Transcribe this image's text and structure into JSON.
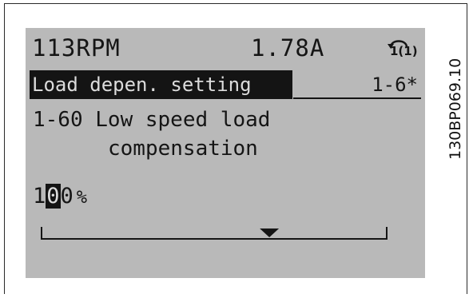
{
  "status": {
    "speed": "113RPM",
    "current": "1.78A",
    "active_setup": "1(1)",
    "setup_icon": "setup-arrow-icon"
  },
  "header": {
    "group_title": "Load depen. setting",
    "group_index": "1-6*"
  },
  "parameter": {
    "line1": "1-60 Low speed load",
    "line2": "compensation"
  },
  "value": {
    "digit1": "1",
    "cursor_digit": "0",
    "digit3": "0",
    "unit": "%",
    "scale_fraction": 0.66
  },
  "figure_code": "130BP069.10"
}
